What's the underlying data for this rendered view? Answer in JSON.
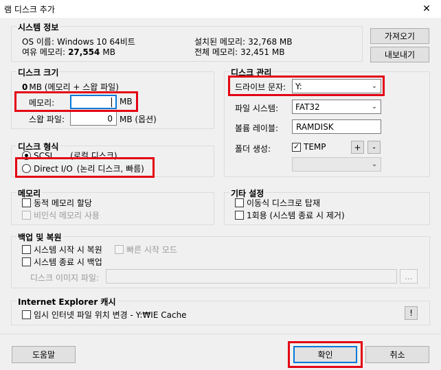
{
  "window": {
    "title": "램 디스크 추가",
    "close_label": "✕"
  },
  "system_info": {
    "group_title": "시스템 정보",
    "os_label": "OS 이름:",
    "os_value": "Windows 10 64비트",
    "free_mem_label": "여유 메모리:",
    "free_mem_value": "27,554",
    "free_mem_unit": "MB",
    "installed_mem_label": "설치된 메모리:",
    "installed_mem_value": "32,768 MB",
    "total_mem_label": "전체 메모리:",
    "total_mem_value": "32,451 MB",
    "import_button": "가져오기",
    "export_button": "내보내기"
  },
  "disk_size": {
    "group_title": "디스크 크기",
    "total_value": "0",
    "total_suffix": "MB (메모리 + 스왑 파일)",
    "memory_label": "메모리:",
    "memory_value": "",
    "memory_unit": "MB",
    "swap_label": "스왑 파일:",
    "swap_value": "0",
    "swap_unit": "MB (옵션)"
  },
  "disk_type": {
    "group_title": "디스크 형식",
    "scsi_label": "SCSI",
    "scsi_desc": "(로컬 디스크)",
    "direct_label": "Direct I/O",
    "direct_desc": "(논리 디스크, 빠름)"
  },
  "disk_manage": {
    "group_title": "디스크 관리",
    "drive_letter_label": "드라이브 문자:",
    "drive_letter_value": "Y:",
    "fs_label": "파일 시스템:",
    "fs_value": "FAT32",
    "volume_label": "볼륨 레이블:",
    "volume_value": "RAMDISK",
    "folder_label": "폴더 생성:",
    "folder_checkbox_label": "TEMP",
    "plus_button": "+",
    "minus_button": "-",
    "folder_dropdown_value": ""
  },
  "memory": {
    "group_title": "메모리",
    "dynamic_label": "동적 메모리 할당",
    "paged_label": "비인식 메모리 사용"
  },
  "other": {
    "group_title": "기타 설정",
    "removable_label": "이동식 디스크로 탑재",
    "once_label": "1회용 (시스템 종료 시 제거)"
  },
  "backup": {
    "group_title": "백업 및 복원",
    "restore_label": "시스템 시작 시 복원",
    "fast_label": "빠른 시작 모드",
    "backup_label": "시스템 종료 시 백업",
    "image_label": "디스크 이미지 파일:",
    "image_value": "",
    "browse_button": "..."
  },
  "ie_cache": {
    "group_title": "Internet Explorer 캐시",
    "temp_label": "임시 인터넷 파일 위치 변경 - Y:₩IE Cache",
    "info_button": "!"
  },
  "footer": {
    "help_button": "도움말",
    "ok_button": "확인",
    "cancel_button": "취소"
  },
  "colors": {
    "highlight": "#e30012",
    "focus": "#0078d7"
  }
}
